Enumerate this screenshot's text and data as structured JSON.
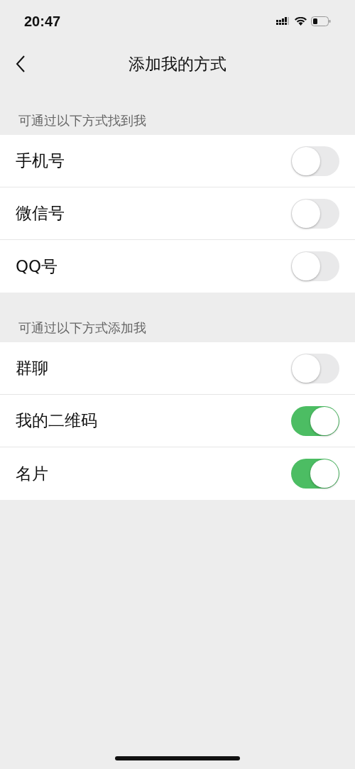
{
  "status_bar": {
    "time": "20:47"
  },
  "nav": {
    "title": "添加我的方式"
  },
  "sections": [
    {
      "header": "可通过以下方式找到我",
      "items": [
        {
          "label": "手机号",
          "on": false
        },
        {
          "label": "微信号",
          "on": false
        },
        {
          "label": "QQ号",
          "on": false
        }
      ]
    },
    {
      "header": "可通过以下方式添加我",
      "items": [
        {
          "label": "群聊",
          "on": false
        },
        {
          "label": "我的二维码",
          "on": true
        },
        {
          "label": "名片",
          "on": true
        }
      ]
    }
  ]
}
